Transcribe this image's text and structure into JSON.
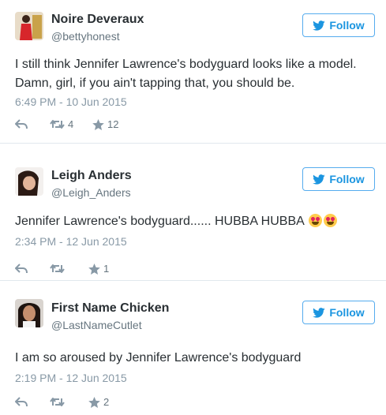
{
  "follow_label": "Follow",
  "colors": {
    "accent": "#1b95e0",
    "border": "#55acee",
    "muted": "#8899a6"
  },
  "tweets": [
    {
      "name": "Noire Deveraux",
      "handle": "@bettyhonest",
      "text_lines": [
        "I still think Jennifer Lawrence's bodyguard looks like a model.",
        "Damn, girl, if you ain't tapping that, you should be."
      ],
      "time": "6:49 PM - 10 Jun 2015",
      "retweets": "4",
      "likes": "12"
    },
    {
      "name": "Leigh Anders",
      "handle": "@Leigh_Anders",
      "text": "Jennifer Lawrence's bodyguard...... HUBBA HUBBA",
      "emoji": "heart-eyes",
      "time": "2:34 PM - 12 Jun 2015",
      "likes": "1"
    },
    {
      "name": "First Name Chicken",
      "handle": "@LastNameCutlet",
      "text": "I am so aroused by Jennifer Lawrence's bodyguard",
      "time": "2:19 PM - 12 Jun 2015",
      "likes": "2"
    }
  ],
  "icons": {
    "reply": "reply-icon",
    "retweet": "retweet-icon",
    "like": "star-icon",
    "bird": "twitter-bird-icon"
  }
}
